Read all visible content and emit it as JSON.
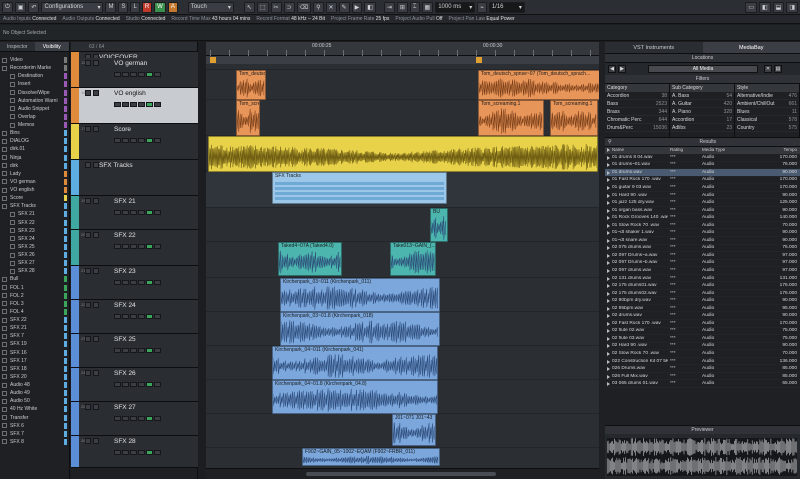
{
  "toolbar": {
    "configurations_label": "Configurations",
    "mode_label": "Touch",
    "m_label": "M",
    "s_label": "S",
    "l_label": "L",
    "r_label": "R",
    "w_label": "W",
    "a_label": "A",
    "grid_value": "1000 ms",
    "quantize_value": "1/16"
  },
  "status": [
    {
      "k": "Audio Inputs",
      "v": "Connected"
    },
    {
      "k": "Audio Outputs",
      "v": "Connected"
    },
    {
      "k": "Studio",
      "v": "Connected"
    },
    {
      "k": "Record Time Max",
      "v": "43 hours 04 mins"
    },
    {
      "k": "Record Format",
      "v": "48 kHz – 24 Bit"
    },
    {
      "k": "Project Frame Rate",
      "v": "25 fps"
    },
    {
      "k": "Project Audio Pull",
      "v": "Off"
    },
    {
      "k": "Project Pan Law",
      "v": "Equal Power"
    }
  ],
  "selection_info": "No Object Selected",
  "inspector": {
    "tabs": [
      "Inspector",
      "Visibility"
    ],
    "items": [
      {
        "label": "Video",
        "indent": 1,
        "color": "#7a7a7a"
      },
      {
        "label": "Recorderim Marke",
        "indent": 1,
        "color": "#7a7a7a"
      },
      {
        "label": "Destination",
        "indent": 2,
        "color": "#9b59b6"
      },
      {
        "label": "Insert",
        "indent": 2,
        "color": "#9b59b6"
      },
      {
        "label": "Dissolve/Wipe",
        "indent": 2,
        "color": "#9b59b6"
      },
      {
        "label": "Automation Warni",
        "indent": 2,
        "color": "#9b59b6"
      },
      {
        "label": "Audio Snippet",
        "indent": 2,
        "color": "#9b59b6"
      },
      {
        "label": "Overlap",
        "indent": 2,
        "color": "#9b59b6"
      },
      {
        "label": "Memos",
        "indent": 2,
        "color": "#9b59b6"
      },
      {
        "label": "Bins",
        "indent": 1,
        "color": "#5dade2"
      },
      {
        "label": "DIALOG",
        "indent": 1,
        "color": "#5dade2"
      },
      {
        "label": "dirk.01",
        "indent": 1,
        "color": "#5dade2"
      },
      {
        "label": "Ninja",
        "indent": 1,
        "color": "#5dade2"
      },
      {
        "label": "dirk",
        "indent": 1,
        "color": "#5dade2"
      },
      {
        "label": "Lady",
        "indent": 1,
        "color": "#e08a3c"
      },
      {
        "label": "VO german",
        "indent": 1,
        "color": "#e08a3c"
      },
      {
        "label": "VO english",
        "indent": 1,
        "color": "#e08a3c"
      },
      {
        "label": "Score",
        "indent": 1,
        "color": "#e8d24a"
      },
      {
        "label": "SFX Tracks",
        "indent": 1,
        "color": "#5dade2"
      },
      {
        "label": "SFX 21",
        "indent": 2,
        "color": "#5dade2"
      },
      {
        "label": "SFX 22",
        "indent": 2,
        "color": "#5dade2"
      },
      {
        "label": "SFX 23",
        "indent": 2,
        "color": "#5dade2"
      },
      {
        "label": "SFX 24",
        "indent": 2,
        "color": "#5dade2"
      },
      {
        "label": "SFX 25",
        "indent": 2,
        "color": "#5dade2"
      },
      {
        "label": "SFX 26",
        "indent": 2,
        "color": "#5dade2"
      },
      {
        "label": "SFX 27",
        "indent": 2,
        "color": "#5dade2"
      },
      {
        "label": "SFX 28",
        "indent": 2,
        "color": "#5dade2"
      },
      {
        "label": "Bull",
        "indent": 1,
        "color": "#3ba55c"
      },
      {
        "label": "FOL 1",
        "indent": 1,
        "color": "#3ba55c"
      },
      {
        "label": "FOL 2",
        "indent": 1,
        "color": "#3ba55c"
      },
      {
        "label": "FOL 3",
        "indent": 1,
        "color": "#3ba55c"
      },
      {
        "label": "FOL 4",
        "indent": 1,
        "color": "#3ba55c"
      },
      {
        "label": "SFX 22",
        "indent": 1,
        "color": "#5dade2"
      },
      {
        "label": "SFX 21",
        "indent": 1,
        "color": "#5dade2"
      },
      {
        "label": "SFX 7",
        "indent": 1,
        "color": "#5dade2"
      },
      {
        "label": "SFX 19",
        "indent": 1,
        "color": "#5dade2"
      },
      {
        "label": "SFX 16",
        "indent": 1,
        "color": "#5dade2"
      },
      {
        "label": "SFX 17",
        "indent": 1,
        "color": "#5dade2"
      },
      {
        "label": "SFX 18",
        "indent": 1,
        "color": "#5dade2"
      },
      {
        "label": "SFX 20",
        "indent": 1,
        "color": "#5dade2"
      },
      {
        "label": "Audio 48",
        "indent": 1,
        "color": "#5dade2"
      },
      {
        "label": "Audio 49",
        "indent": 1,
        "color": "#5dade2"
      },
      {
        "label": "Audio 50",
        "indent": 1,
        "color": "#5dade2"
      },
      {
        "label": "40 Hz White",
        "indent": 1,
        "color": "#5dade2"
      },
      {
        "label": "Transfer",
        "indent": 1,
        "color": "#5dade2"
      },
      {
        "label": "SFX 6",
        "indent": 1,
        "color": "#5dade2"
      },
      {
        "label": "SFX 7",
        "indent": 1,
        "color": "#5dade2"
      },
      {
        "label": "SFX 8",
        "indent": 1,
        "color": "#5dade2"
      }
    ]
  },
  "track_counter": "63 / 64",
  "tracks": [
    {
      "name": "VOICEOVER",
      "num": "",
      "color": "#e08a3c",
      "type": "folder"
    },
    {
      "name": "VO german",
      "num": "15",
      "color": "#e08a3c"
    },
    {
      "name": "VO english",
      "num": "16",
      "color": "#e08a3c"
    },
    {
      "name": "Score",
      "num": "17",
      "color": "#e8d24a"
    },
    {
      "name": "SFX Tracks",
      "num": "",
      "color": "#5dade2",
      "type": "folder"
    },
    {
      "name": "SFX 21",
      "num": "19",
      "color": "#3fa8a0"
    },
    {
      "name": "SFX 22",
      "num": "20",
      "color": "#3fa8a0"
    },
    {
      "name": "SFX 23",
      "num": "21",
      "color": "#5b8ed6"
    },
    {
      "name": "SFX 24",
      "num": "22",
      "color": "#5b8ed6"
    },
    {
      "name": "SFX 25",
      "num": "23",
      "color": "#5b8ed6"
    },
    {
      "name": "SFX 26",
      "num": "24",
      "color": "#5b8ed6"
    },
    {
      "name": "SFX 27",
      "num": "25",
      "color": "#5b8ed6"
    },
    {
      "name": "SFX 28",
      "num": "26",
      "color": "#5b8ed6"
    }
  ],
  "ruler": {
    "labels": [
      "00:00:25",
      "00:00:30"
    ]
  },
  "events": [
    {
      "lane": 1,
      "label": "Tom_deutsch",
      "color": "#e8955a"
    },
    {
      "lane": 1,
      "label": "Tom_deutsch_spnse~07 (Tom_deutsch_sprach...",
      "color": "#e8955a"
    },
    {
      "lane": 2,
      "label": "Tom_scre",
      "color": "#e8955a"
    },
    {
      "lane": 2,
      "label": "Tom_screaming.1",
      "color": "#e8955a"
    },
    {
      "lane": 2,
      "label": "Tom_screaming.1",
      "color": "#e8955a"
    },
    {
      "lane": 3,
      "label": "",
      "color": "#e8d24a"
    },
    {
      "lane": 4,
      "label": "SFX Tracks",
      "color": "#9cc7e8"
    },
    {
      "lane": 5,
      "label": "BU",
      "color": "#4cb5ae"
    },
    {
      "lane": 6,
      "label": "Taked4~07A (Taked4.0)",
      "color": "#4cb5ae"
    },
    {
      "lane": 6,
      "label": "Take013~GAIN_(...",
      "color": "#4cb5ae"
    },
    {
      "lane": 7,
      "label": "Kirchenpark_03~011 (Kirchenpark_011)",
      "color": "#7ba7dc"
    },
    {
      "lane": 8,
      "label": "Kirchenpark_03~01.8 (Kirchenpark_018)",
      "color": "#7ba7dc"
    },
    {
      "lane": 9,
      "label": "Kirchenpark_04~011 (Kirchenpark_041)",
      "color": "#7ba7dc"
    },
    {
      "lane": 10,
      "label": "Kirchenpark_04~01.8 (Kirchenpark_04.8)",
      "color": "#7ba7dc"
    },
    {
      "lane": 11,
      "label": "J01~071 J01~43",
      "color": "#7ba7dc"
    },
    {
      "lane": 12,
      "label": "F902~GAIN_05~1002~EQAM (F902~FRBR_011)",
      "color": "#7ba7dc"
    }
  ],
  "right": {
    "tabs": [
      "VST Instruments",
      "MediaBay"
    ],
    "locations_label": "Locations",
    "location_value": "All Media",
    "filters_label": "Filters",
    "filter_cols": [
      {
        "title": "Category",
        "rows": [
          [
            "Accordion",
            "38"
          ],
          [
            "Bass",
            "2523"
          ],
          [
            "Brass",
            "344"
          ],
          [
            "Chromatic Perc",
            "644"
          ],
          [
            "Drum&Perc",
            "15036"
          ]
        ]
      },
      {
        "title": "Sub Category",
        "rows": [
          [
            "A. Bass",
            "54"
          ],
          [
            "A. Guitar",
            "420"
          ],
          [
            "A. Piano",
            "328"
          ],
          [
            "Accordion",
            "17"
          ],
          [
            "Adlibs",
            "23"
          ]
        ]
      },
      {
        "title": "Style",
        "rows": [
          [
            "Alternative/Indie",
            "476"
          ],
          [
            "Ambient/ChillOut",
            "661"
          ],
          [
            "Blues",
            "11"
          ],
          [
            "Classical",
            "578"
          ],
          [
            "Country",
            "575"
          ]
        ]
      }
    ],
    "results_label": "Results",
    "result_columns": [
      "Name",
      "Rating",
      "Media Type",
      "Tempo"
    ],
    "results": [
      [
        "01 drums 8 04.wav",
        "***",
        "Audio",
        "170.000"
      ],
      [
        "01 drums~01.wav",
        "***",
        "Audio",
        "76.000"
      ],
      [
        "01 drums.wav",
        "***",
        "Audio",
        "90.000"
      ],
      [
        "01 Fast Rock 170 .wav",
        "***",
        "Audio",
        "170.000"
      ],
      [
        "01 guitar 9 03.wav",
        "***",
        "Audio",
        "170.000"
      ],
      [
        "01 Hard 90 .wav",
        "***",
        "Audio",
        "90.000"
      ],
      [
        "01 jazz 125 dry.wav",
        "***",
        "Audio",
        "125.000"
      ],
      [
        "01 organ bass.wav",
        "***",
        "Audio",
        "90.000"
      ],
      [
        "01 Rock Grooves 140 .wav",
        "***",
        "Audio",
        "140.000"
      ],
      [
        "01 Slow Rock 70 .wav",
        "***",
        "Audio",
        "70.000"
      ],
      [
        "01~dt shaker 1.wav",
        "***",
        "Audio",
        "90.000"
      ],
      [
        "01~dt snare.wav",
        "***",
        "Audio",
        "90.000"
      ],
      [
        "02 075 drums.wav",
        "***",
        "Audio",
        "75.000"
      ],
      [
        "02 097 Drums~a.wav",
        "***",
        "Audio",
        "97.000"
      ],
      [
        "02 097 Drums~b.wav",
        "***",
        "Audio",
        "97.000"
      ],
      [
        "02 097 drums.wav",
        "***",
        "Audio",
        "97.000"
      ],
      [
        "02 131 drums.wav",
        "***",
        "Audio",
        "131.000"
      ],
      [
        "02 175 drums01.wav",
        "***",
        "Audio",
        "175.000"
      ],
      [
        "02 175 drums02.wav",
        "***",
        "Audio",
        "175.000"
      ],
      [
        "02 90bpm dry.wav",
        "***",
        "Audio",
        "90.000"
      ],
      [
        "02 95bpm.wav",
        "***",
        "Audio",
        "95.000"
      ],
      [
        "02 drums.wav",
        "***",
        "Audio",
        "90.000"
      ],
      [
        "02 Fast Rock 170 .wav",
        "***",
        "Audio",
        "170.000"
      ],
      [
        "02 flute 02.wav",
        "***",
        "Audio",
        "75.000"
      ],
      [
        "02 flute 03.wav",
        "***",
        "Audio",
        "75.000"
      ],
      [
        "02 Hard 90 .wav",
        "***",
        "Audio",
        "90.000"
      ],
      [
        "02 Slow Rock 70 .wav",
        "***",
        "Audio",
        "70.000"
      ],
      [
        "022 Construction Kit 07 5K.wav",
        "***",
        "Audio",
        "136.000"
      ],
      [
        "026 Drums.wav",
        "***",
        "Audio",
        "85.000"
      ],
      [
        "026 Full Mix.wav",
        "***",
        "Audio",
        "85.000"
      ],
      [
        "03 065 drums 01.wav",
        "***",
        "Audio",
        "65.000"
      ]
    ],
    "selected_index": 2,
    "previewer_label": "Previewer"
  }
}
